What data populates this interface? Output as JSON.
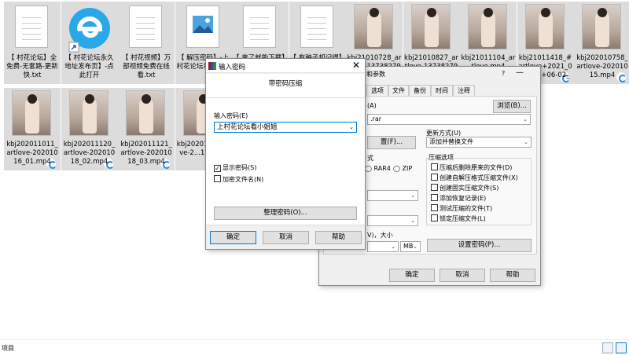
{
  "explorer": {
    "status_text": "项目",
    "files": [
      {
        "name": "【 村花论坛】全免费-无套路-更新快.txt",
        "kind": "text",
        "selected": true
      },
      {
        "name": "【 村花论坛永久地址发布页】-点此打开",
        "kind": "shortcut",
        "selected": true
      },
      {
        "name": "【 村花视频】万部视频免费在线看.txt",
        "kind": "text",
        "selected": true
      },
      {
        "name": "【 解压密码】-上村花论坛看小姐姐",
        "kind": "image",
        "selected": true
      },
      {
        "name": "【 来了就能下载】",
        "kind": "text",
        "selected": true
      },
      {
        "name": "【 有种子却记得】",
        "kind": "text",
        "selected": true
      },
      {
        "name": "kbj21010728_artlove-13738279",
        "kind": "video",
        "selected": true
      },
      {
        "name": "kbj21010827_artlove-13738279",
        "kind": "video",
        "selected": true
      },
      {
        "name": "kbj21011104_artlove.mp4",
        "kind": "video",
        "selected": true
      },
      {
        "name": "kbj21011418_#artlove+2021_05445_+06-02_",
        "kind": "video",
        "selected": true
      },
      {
        "name": "kbj202010758_artlove-20201015.mp4",
        "kind": "video",
        "selected": true
      },
      {
        "name": "kbj202011011_artlove-20201016_01.mp4",
        "kind": "video",
        "selected": true
      },
      {
        "name": "kbj202011120_artlove-20201018_02.mp4",
        "kind": "video",
        "selected": true
      },
      {
        "name": "kbj202011121_artlove-20201018_03.mp4",
        "kind": "video",
        "selected": true
      },
      {
        "name": "kbj20201...artlove-2...19_03...",
        "kind": "video",
        "selected": true
      }
    ]
  },
  "archive_dialog": {
    "title_fragment": "和参数",
    "help_icon": "?",
    "tabs": [
      "选项",
      "文件",
      "备份",
      "时间",
      "注释"
    ],
    "archive_name_label": "(A)",
    "browse_button": "浏览(B)...",
    "archive_name_value": ".rar",
    "update_mode_label": "更新方式(U)",
    "update_mode_value": "添加并替换文件",
    "profiles_button_fragment": "置(F)...",
    "format_label_fragment": "式",
    "format_options": [
      "RAR4",
      "ZIP"
    ],
    "compress_options_label": "压缩选项",
    "compress_options": [
      "压缩后删除原来的文件(D)",
      "创建自解压格式压缩文件(X)",
      "创建固实压缩文件(S)",
      "添加恢复记录(E)",
      "测试压缩的文件(T)",
      "锁定压缩文件(L)"
    ],
    "split_label_fragment": "V)，大小",
    "split_unit": "MB",
    "set_password_button": "设置密码(P)...",
    "ok_button": "确定",
    "cancel_button": "取消",
    "help_button": "帮助"
  },
  "password_dialog": {
    "title": "输入密码",
    "header": "带密码压缩",
    "password_label": "输入密码(E)",
    "password_value": "上村花论坛看小姐姐",
    "show_password_label": "显示密码(S)",
    "show_password_checked": true,
    "encrypt_names_label": "加密文件名(N)",
    "encrypt_names_checked": false,
    "organize_button": "整理密码(O)...",
    "ok_button": "确定",
    "cancel_button": "取消",
    "help_button": "帮助",
    "close_glyph": "✕",
    "check_glyph": "✓"
  }
}
